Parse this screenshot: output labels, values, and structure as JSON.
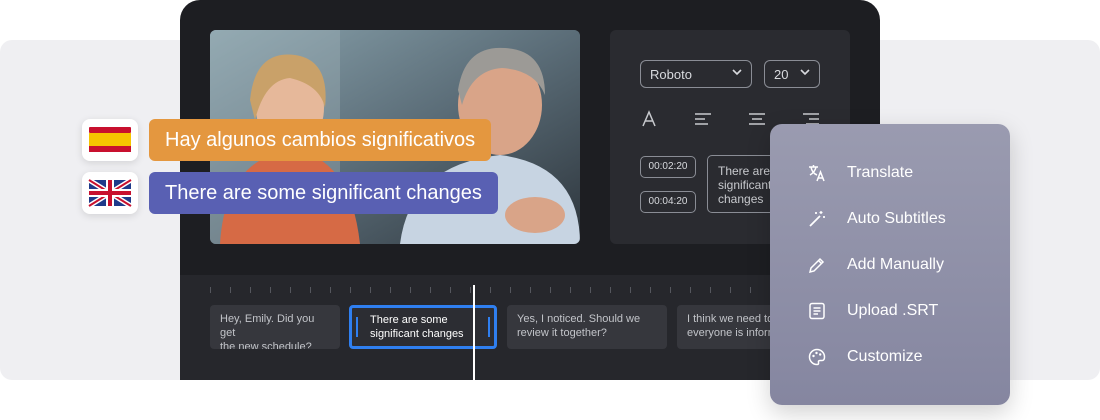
{
  "editor": {
    "font_select": "Roboto",
    "size_select": "20",
    "timecodes": [
      "00:02:20",
      "00:04:20"
    ],
    "subtitle_preview": [
      "There are",
      "significant",
      "changes"
    ]
  },
  "timeline": {
    "clips": [
      {
        "lines": [
          "Hey, Emily. Did you get",
          "the new schedule?"
        ]
      },
      {
        "lines": [
          "There are some",
          "significant changes"
        ],
        "active": true
      },
      {
        "lines": [
          "Yes, I noticed. Should we",
          "review it together?"
        ]
      },
      {
        "lines": [
          "I think we need to",
          "everyone is inform"
        ]
      }
    ]
  },
  "captions": {
    "spanish": "Hay algunos cambios significativos",
    "english": "There are some significant changes"
  },
  "menu": {
    "items": [
      {
        "label": "Translate",
        "icon": "translate-icon"
      },
      {
        "label": "Auto Subtitles",
        "icon": "magic-wand-icon"
      },
      {
        "label": "Add Manually",
        "icon": "pencil-icon"
      },
      {
        "label": "Upload .SRT",
        "icon": "document-icon"
      },
      {
        "label": "Customize",
        "icon": "palette-icon"
      }
    ]
  },
  "colors": {
    "accent": "#2f7ff0",
    "spanish_pill": "#e4973f",
    "english_pill": "#5960b3"
  }
}
